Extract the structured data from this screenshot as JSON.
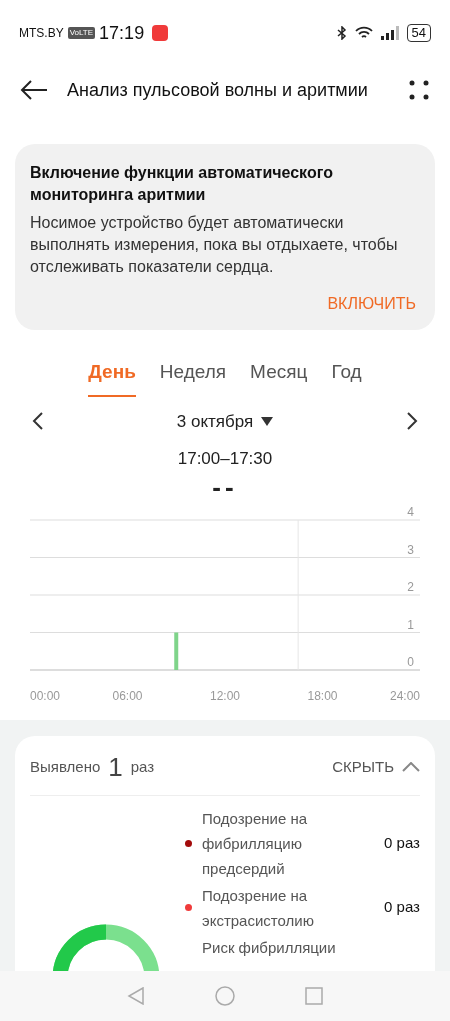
{
  "status_bar": {
    "carrier": "MTS.BY",
    "volte": "VoLTE",
    "time": "17:19",
    "battery": "54"
  },
  "header": {
    "title": "Анализ пульсовой волны и аритмии"
  },
  "banner": {
    "title": "Включение функции автоматического мониторинга аритмии",
    "text": "Носимое устройство будет автоматически выполнять измерения, пока вы отдыхаете, чтобы отслеживать показатели сердца.",
    "action": "ВКЛЮЧИТЬ"
  },
  "tabs": [
    {
      "label": "День",
      "selected": true
    },
    {
      "label": "Неделя",
      "selected": false
    },
    {
      "label": "Месяц",
      "selected": false
    },
    {
      "label": "Год",
      "selected": false
    }
  ],
  "date": "3 октября",
  "time_range": "17:00–17:30",
  "reading": "--",
  "chart_data": {
    "type": "bar",
    "x": [
      9
    ],
    "values": [
      1
    ],
    "xlim": [
      0,
      24
    ],
    "ylim": [
      0,
      4
    ],
    "xticks": [
      {
        "value": 0,
        "label": "00:00"
      },
      {
        "value": 6,
        "label": "06:00"
      },
      {
        "value": 12,
        "label": "12:00"
      },
      {
        "value": 18,
        "label": "18:00"
      },
      {
        "value": 24,
        "label": "24:00"
      }
    ],
    "yticks": [
      0,
      1,
      2,
      3,
      4
    ],
    "grid": true,
    "ref_lines": [
      {
        "axis": "x",
        "value": 16.5
      }
    ]
  },
  "summary": {
    "prefix": "Выявлено",
    "count": "1",
    "suffix": "раз",
    "toggle": "СКРЫТЬ",
    "expanded": true,
    "items": [
      {
        "label": "Подозрение на фибрилляцию предсердий",
        "value": "0 раз",
        "color": "#a30b0b"
      },
      {
        "label": "Подозрение на экстрасистолию",
        "value": "0 раз",
        "color": "#f03b3b"
      },
      {
        "label": "Риск фибрилляции"
      }
    ]
  }
}
